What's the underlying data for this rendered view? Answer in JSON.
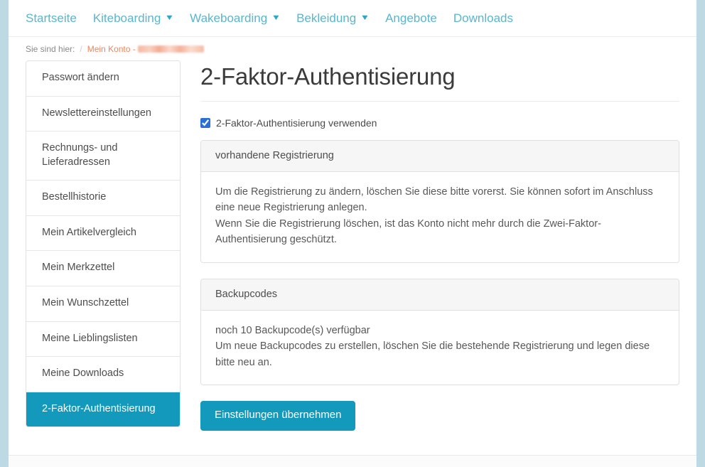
{
  "nav": {
    "items": [
      {
        "label": "Startseite",
        "has_caret": false
      },
      {
        "label": "Kiteboarding",
        "has_caret": true
      },
      {
        "label": "Wakeboarding",
        "has_caret": true
      },
      {
        "label": "Bekleidung",
        "has_caret": true
      },
      {
        "label": "Angebote",
        "has_caret": false
      },
      {
        "label": "Downloads",
        "has_caret": false
      }
    ],
    "caret_glyph": "❯"
  },
  "breadcrumb": {
    "prefix": "Sie sind hier:",
    "separator": "/",
    "account_link": "Mein Konto -",
    "redacted_value": ""
  },
  "sidebar": {
    "items": [
      {
        "label": "Passwort ändern",
        "active": false
      },
      {
        "label": "Newslettereinstellungen",
        "active": false
      },
      {
        "label": "Rechnungs- und Lieferadressen",
        "active": false
      },
      {
        "label": "Bestellhistorie",
        "active": false
      },
      {
        "label": "Mein Artikelvergleich",
        "active": false
      },
      {
        "label": "Mein Merkzettel",
        "active": false
      },
      {
        "label": "Mein Wunschzettel",
        "active": false
      },
      {
        "label": "Meine Lieblingslisten",
        "active": false
      },
      {
        "label": "Meine Downloads",
        "active": false
      },
      {
        "label": "2-Faktor-Authentisierung",
        "active": true
      }
    ]
  },
  "main": {
    "title": "2-Faktor-Authentisierung",
    "checkbox": {
      "label": "2-Faktor-Authentisierung verwenden",
      "checked": true
    },
    "panels": [
      {
        "heading": "vorhandene Registrierung",
        "lines": [
          "Um die Registrierung zu ändern, löschen Sie diese bitte vorerst. Sie können sofort im Anschluss eine neue Registrierung anlegen.",
          "Wenn Sie die Registrierung löschen, ist das Konto nicht mehr durch die Zwei-Faktor-Authentisierung geschützt."
        ]
      },
      {
        "heading": "Backupcodes",
        "lines": [
          "noch 10 Backupcode(s) verfügbar",
          "Um neue Backupcodes zu erstellen, löschen Sie die bestehende Registrierung und legen diese bitte neu an."
        ]
      }
    ],
    "submit_label": "Einstellungen übernehmen"
  },
  "colors": {
    "accent_teal": "#1399bb",
    "nav_link": "#5ab6cc",
    "breadcrumb_link": "#f0845a",
    "page_edge": "#bcd9e4",
    "checkbox_blue": "#2b6fd4"
  }
}
